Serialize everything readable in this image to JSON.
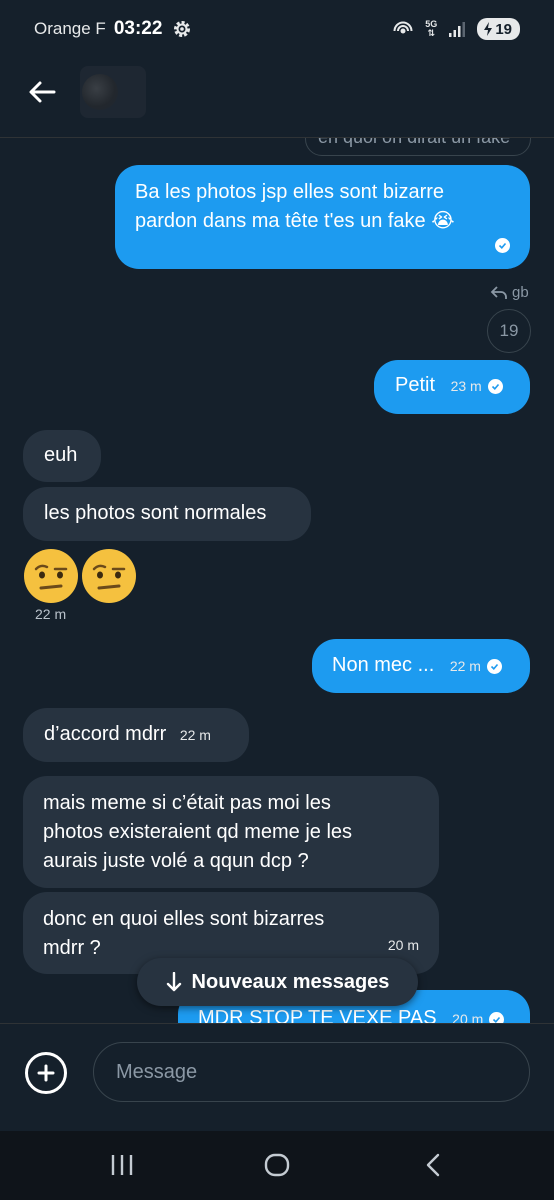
{
  "status_bar": {
    "carrier": "Orange F",
    "time": "03:22",
    "network": "5G",
    "battery": "19",
    "icons": [
      "gear-icon",
      "hotspot-icon",
      "network-5g-icon",
      "signal-icon",
      "battery-icon"
    ]
  },
  "header": {
    "back_icon": "arrow-left-icon"
  },
  "messages": [
    {
      "side": "out",
      "quoted_text": "en quoi on dirait un fake",
      "lines": [
        "Ba les photos jsp elles sont bizarre",
        "pardon dans ma tête t'es un fake 😭"
      ],
      "time": ""
    },
    {
      "reply_to": "gb",
      "reaction_count": "19"
    },
    {
      "side": "out",
      "text": "Petit",
      "time": "23 m"
    },
    {
      "side": "in",
      "text": "euh"
    },
    {
      "side": "in",
      "text": "les photos sont normales"
    },
    {
      "side": "in",
      "emoji": [
        "face-with-raised-eyebrow",
        "face-with-raised-eyebrow"
      ],
      "time": "22 m"
    },
    {
      "side": "out",
      "text": "Non mec ...",
      "time": "22 m"
    },
    {
      "side": "in",
      "text": "d’accord mdrr",
      "time": "22 m"
    },
    {
      "side": "in",
      "lines": [
        "mais meme si c’était pas moi les",
        "photos existeraient qd meme je les",
        "aurais juste volé a qqun dcp ?"
      ]
    },
    {
      "side": "in",
      "lines": [
        "donc en quoi elles sont bizarres",
        "mdrr ?"
      ],
      "time": "20 m"
    },
    {
      "side": "out",
      "text": "MDR STOP TE VEXE PAS",
      "time": "20 m"
    }
  ],
  "new_messages_pill": {
    "label": "Nouveaux messages",
    "icon": "arrow-down-icon"
  },
  "composer": {
    "placeholder": "Message",
    "add_icon": "plus-circle-icon"
  },
  "android_nav": {
    "icons": [
      "recents-icon",
      "home-icon",
      "back-icon"
    ]
  },
  "colors": {
    "background": "#15202b",
    "outgoing": "#1d9bf0",
    "incoming": "#273340"
  }
}
